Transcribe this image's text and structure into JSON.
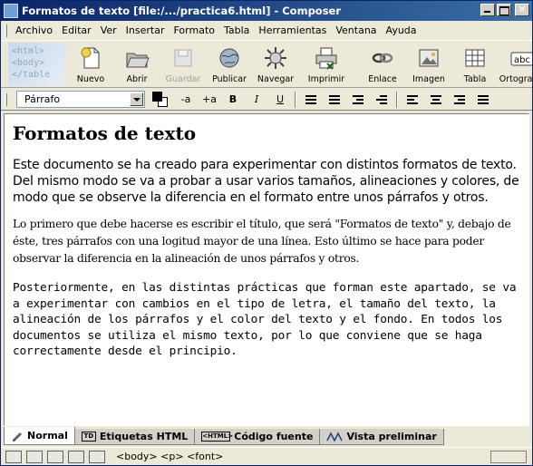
{
  "window": {
    "title": "Formatos de texto [file:/.../practica6.html] - Composer"
  },
  "menu": [
    "Archivo",
    "Editar",
    "Ver",
    "Insertar",
    "Formato",
    "Tabla",
    "Herramientas",
    "Ventana",
    "Ayuda"
  ],
  "brand_text": "<html>\n<body>\n</table",
  "toolbar": {
    "buttons": [
      {
        "label": "Nuevo",
        "icon": "new-page-icon"
      },
      {
        "label": "Abrir",
        "icon": "open-folder-icon"
      },
      {
        "label": "Guardar",
        "icon": "save-disk-icon",
        "disabled": true
      },
      {
        "label": "Publicar",
        "icon": "publish-globe-icon"
      },
      {
        "label": "Navegar",
        "icon": "browse-icon"
      },
      {
        "label": "Imprimir",
        "icon": "print-icon"
      },
      {
        "label": "Enlace",
        "icon": "link-icon"
      },
      {
        "label": "Imagen",
        "icon": "image-icon"
      },
      {
        "label": "Tabla",
        "icon": "table-icon"
      },
      {
        "label": "Ortografía",
        "icon": "spellcheck-icon"
      }
    ]
  },
  "format": {
    "paragraph_style": "Párrafo",
    "text_color": "#000000",
    "bg_color": "#ffffff",
    "smaller_label": "-a",
    "larger_label": "+a",
    "bold_label": "B",
    "italic_label": "I",
    "underline_label": "U"
  },
  "document": {
    "heading": "Formatos de texto",
    "p1": "Este documento se ha creado para experimentar con distintos formatos de texto. Del mismo modo se va a probar a usar varios tamaños, alineaciones y colores, de modo que se observe la diferencia en el formato entre unos párrafos y otros.",
    "p2": "Lo primero que debe hacerse es escribir el título, que será \"Formatos de texto\" y, debajo de éste, tres párrafos con una logitud mayor de una línea. Esto último se hace para poder observar la diferencia en la alineación de unos párrafos y otros.",
    "p3": "Posteriormente, en las distintas prácticas que forman este apartado, se va a experimentar con cambios en el tipo de letra, el tamaño del texto, la alineación de los párrafos y el color del texto y el fondo. En todos los documentos se utiliza el mismo texto, por lo que conviene que se haga correctamente desde el principio."
  },
  "tabs": [
    {
      "label": "Normal",
      "active": true
    },
    {
      "label": "Etiquetas HTML",
      "icon_text": "TD"
    },
    {
      "label": "Código fuente",
      "icon_text": "<HTML>"
    },
    {
      "label": "Vista preliminar"
    }
  ],
  "status": {
    "path": "<body> <p> <font>"
  }
}
